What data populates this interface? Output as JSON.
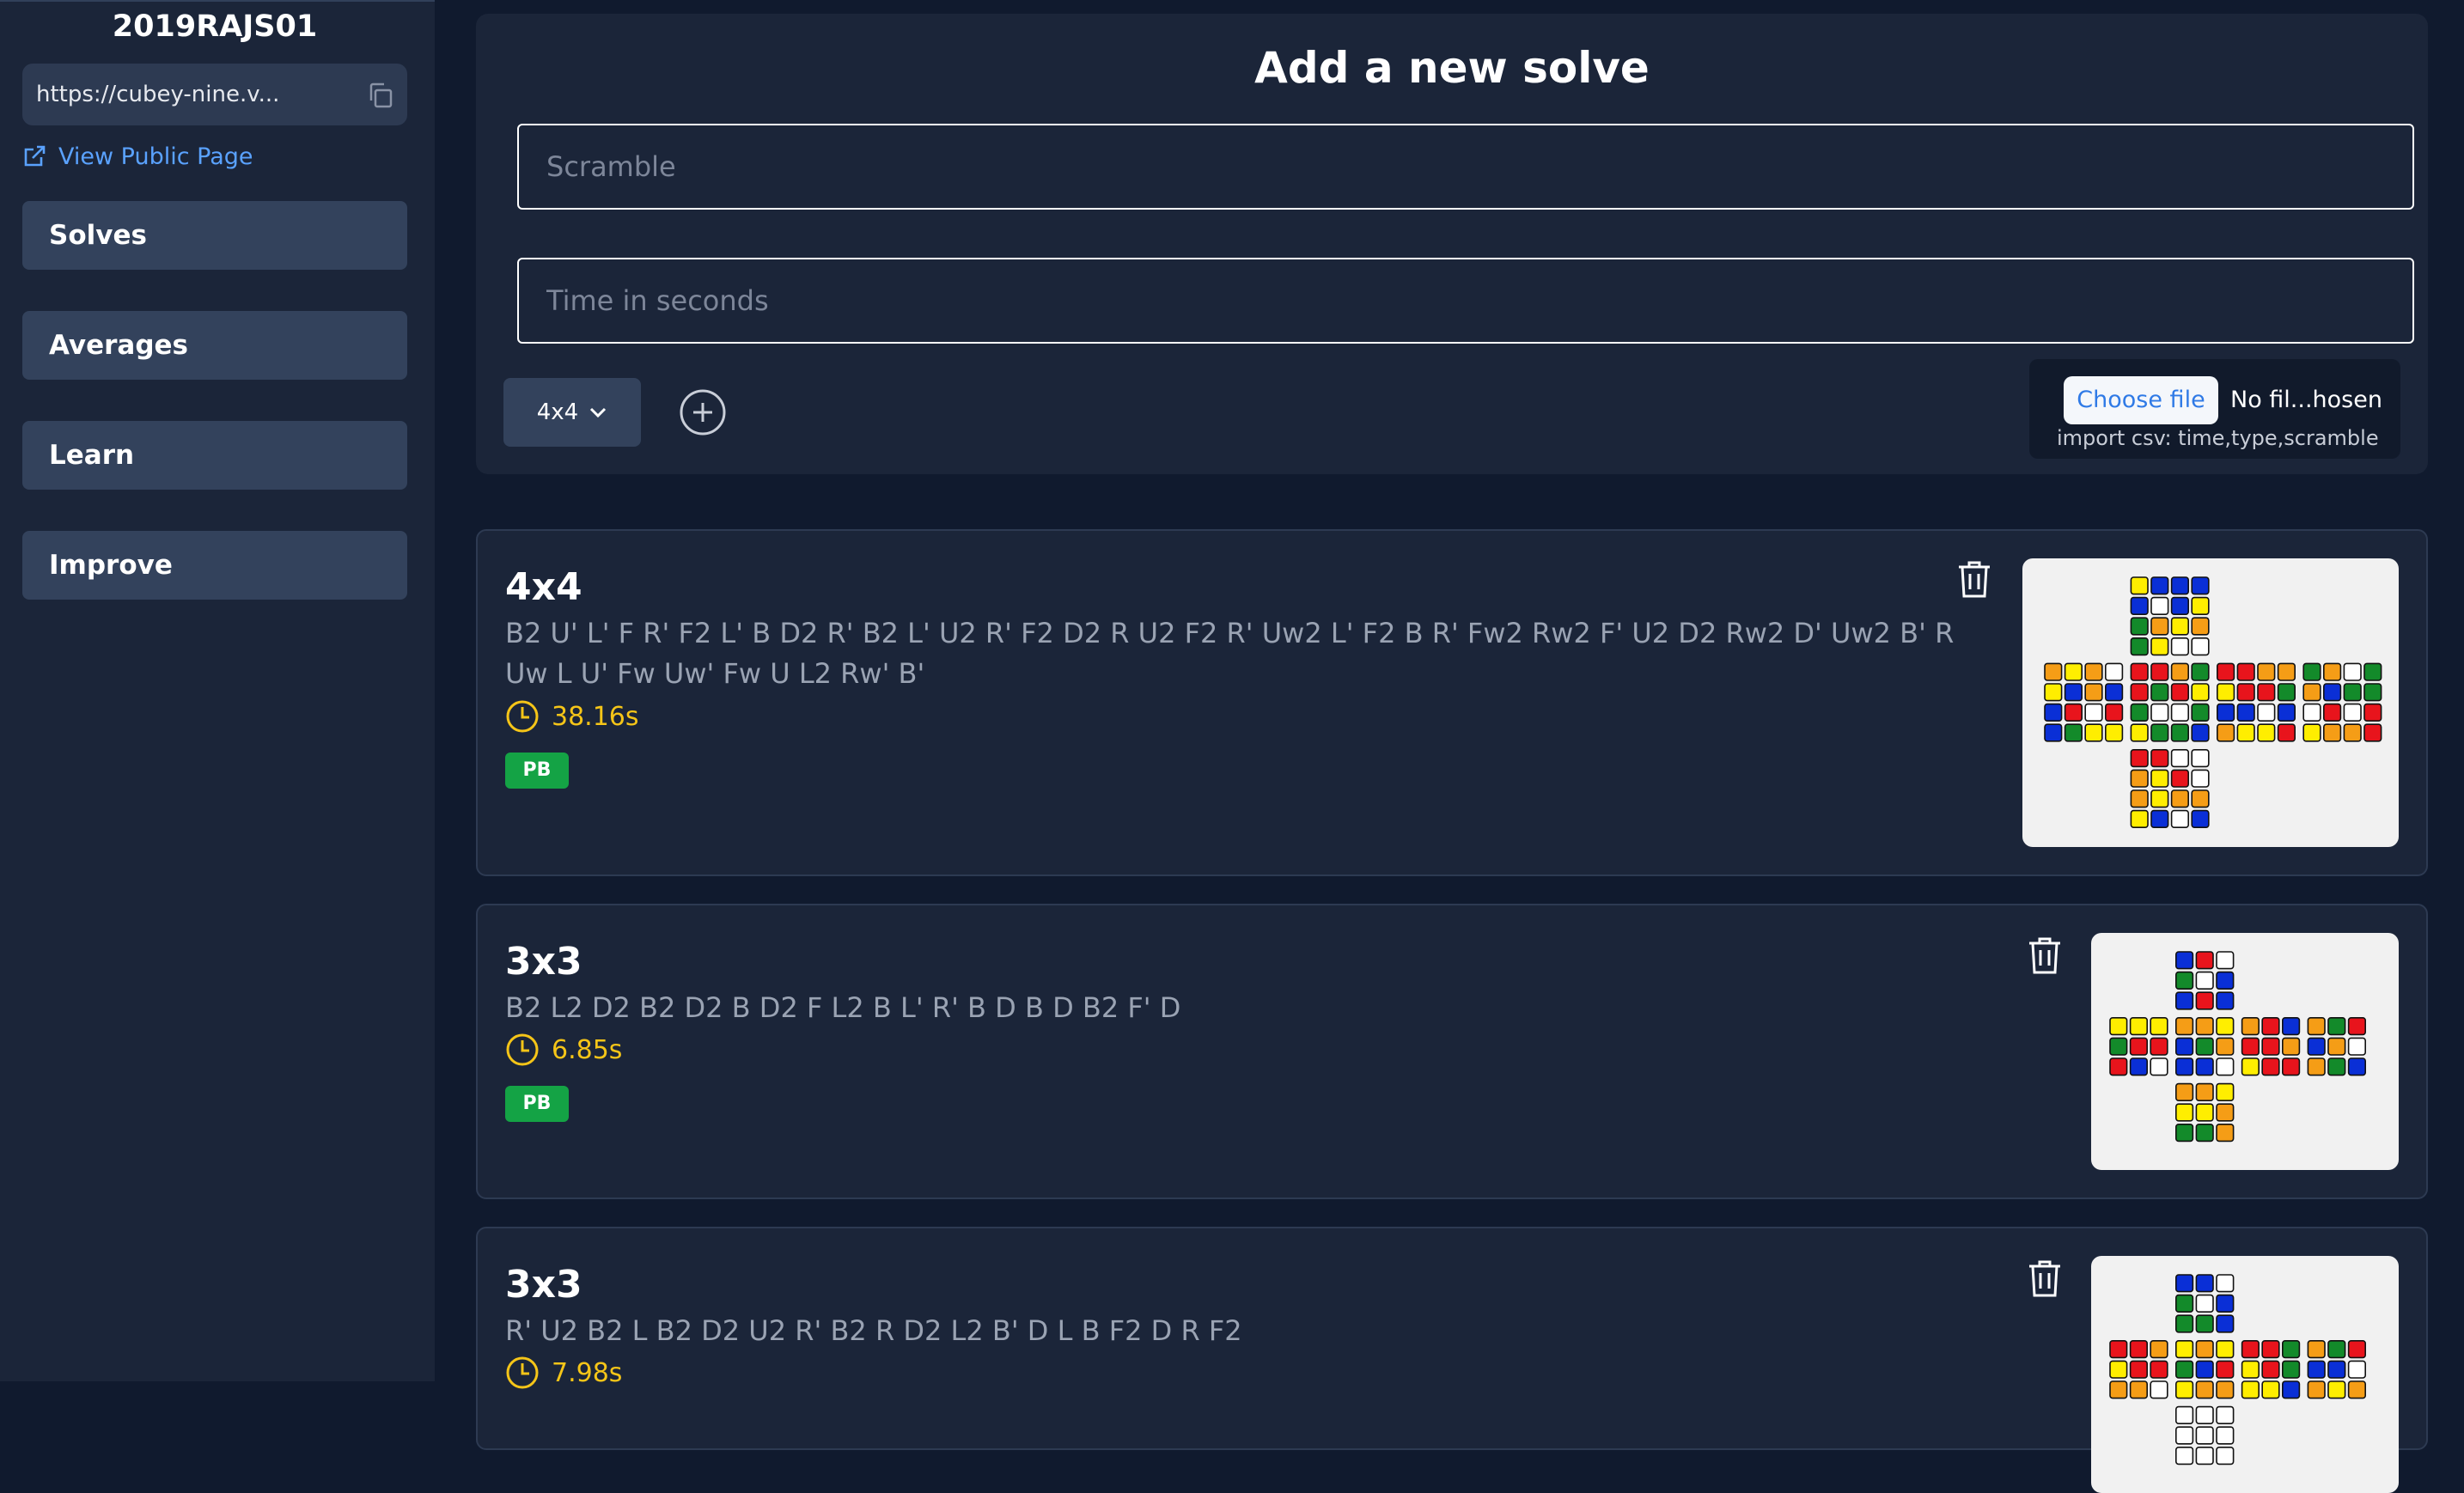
{
  "sidebar": {
    "username": "2019RAJS01",
    "url": "https://cubey-nine.v...",
    "public_link": "View Public Page",
    "nav": [
      "Solves",
      "Averages",
      "Learn",
      "Improve"
    ]
  },
  "add_solve": {
    "title": "Add a new solve",
    "scramble_placeholder": "Scramble",
    "time_placeholder": "Time in seconds",
    "cube_type": "4x4",
    "choose_file_label": "Choose file",
    "no_file_label": "No fil...hosen",
    "import_hint": "import csv: time,type,scramble"
  },
  "colors": {
    "W": "#ffffff",
    "Y": "#ffee00",
    "R": "#e8141c",
    "O": "#f59d16",
    "G": "#138a2a",
    "B": "#0a2fd6",
    "accent": "#5aa2ff",
    "time": "#f5c518",
    "pb": "#14a345"
  },
  "solves": [
    {
      "type": "4x4",
      "scramble_lines": [
        "B2 U' L' F R' F2 L' B D2 R' B2 L' U2 R' F2 D2 R U2 F2 R' Uw2 L' F2 B R' Fw2 Rw2 F' U2 D2 Rw2 D' Uw2 B' R",
        "Uw L U' Fw Uw' Fw U L2 Rw' B'"
      ],
      "time": "38.16s",
      "badge": "PB",
      "net": {
        "U": [
          "YBBB",
          "BWBY",
          "GOYO",
          "GYWW"
        ],
        "L": [
          "OYOW",
          "YBOB",
          "BRWR",
          "BGYY"
        ],
        "F": [
          "RROG",
          "RGRY",
          "GWWG",
          "YGGB"
        ],
        "R": [
          "RROO",
          "YRRG",
          "BBWB",
          "OYYR"
        ],
        "B": [
          "GOWG",
          "OBGG",
          "WRWR",
          "YOOR"
        ],
        "D": [
          "RRWW",
          "OYRW",
          "OYOO",
          "YBWB"
        ]
      }
    },
    {
      "type": "3x3",
      "scramble_lines": [
        "B2 L2 D2 B2 D2 B D2 F L2 B L' R' B D B D B2 F' D"
      ],
      "time": "6.85s",
      "badge": "PB",
      "net": {
        "U": [
          "BRW",
          "GWB",
          "BRB"
        ],
        "L": [
          "YYY",
          "GRR",
          "RBW"
        ],
        "F": [
          "OOY",
          "BGO",
          "BBW"
        ],
        "R": [
          "ORB",
          "RRO",
          "YRR"
        ],
        "B": [
          "OGR",
          "BOW",
          "OGB"
        ],
        "D": [
          "OOY",
          "YYO",
          "GGO"
        ]
      }
    },
    {
      "type": "3x3",
      "scramble_lines": [
        "R' U2 B2 L B2 D2 U2 R' B2 R D2 L2 B' D L B F2 D R F2"
      ],
      "time": "7.98s",
      "badge": "",
      "net": {
        "U": [
          "BBW",
          "GWB",
          "GGB"
        ],
        "L": [
          "RRO",
          "YRR",
          "OOW"
        ],
        "F": [
          "YOY",
          "GBR",
          "YOO"
        ],
        "R": [
          "RRG",
          "YRG",
          "YYB"
        ],
        "B": [
          "OGR",
          "BBW",
          "OYO"
        ],
        "D": [
          "WWW",
          "WWW",
          "WWW"
        ]
      }
    }
  ]
}
